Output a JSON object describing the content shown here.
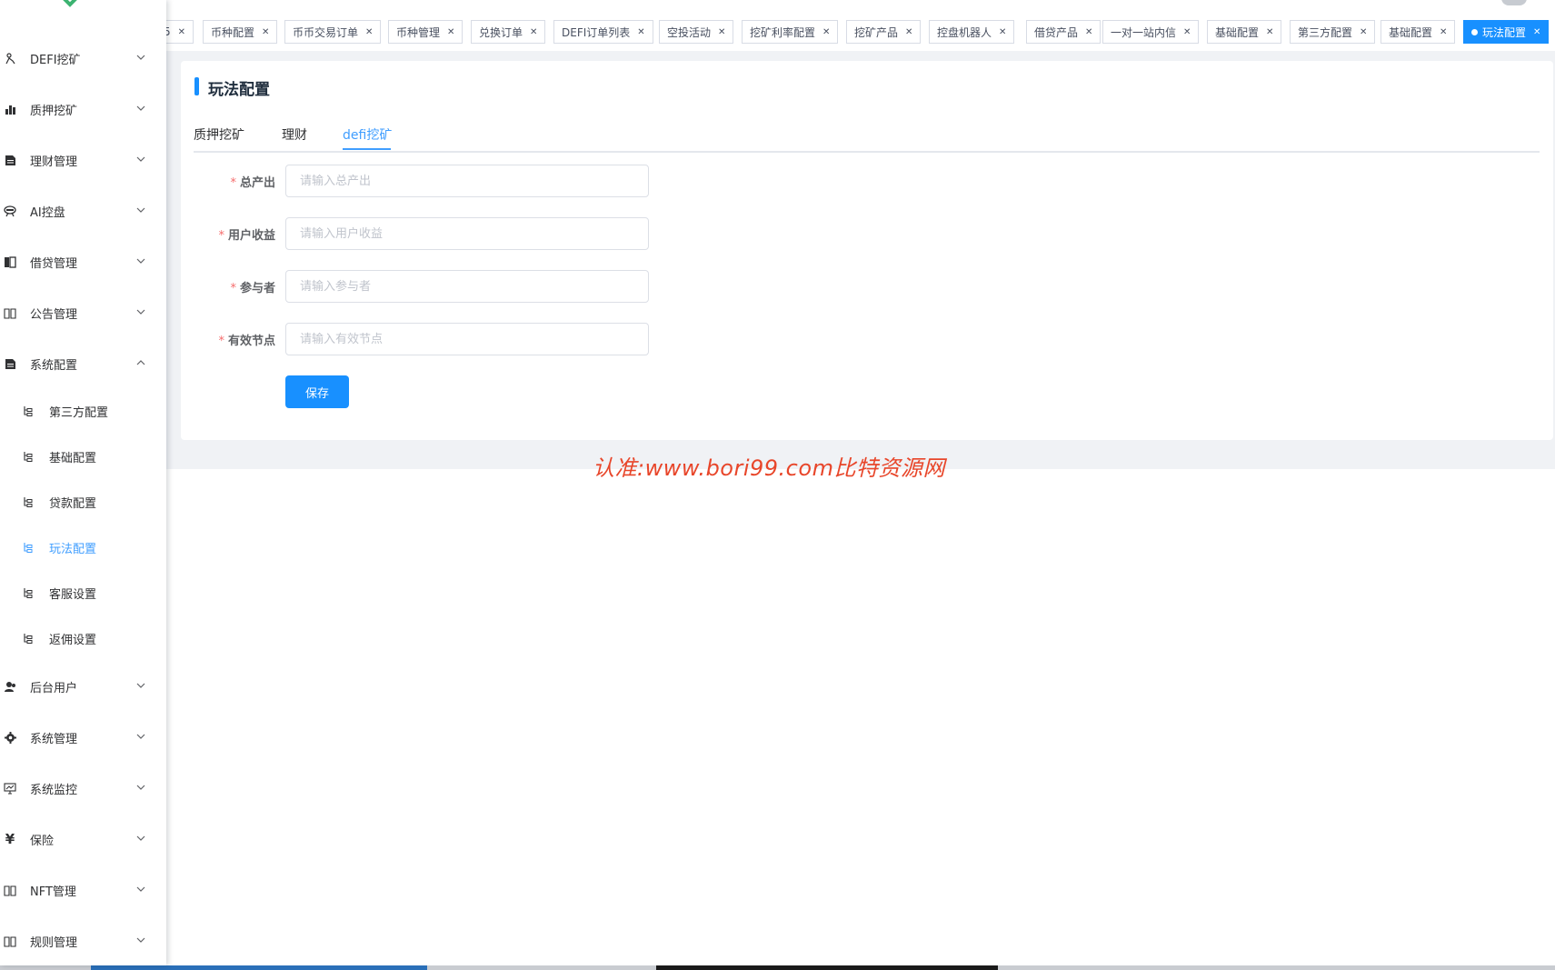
{
  "sidebar": {
    "menus": [
      {
        "label": "DEFI挖矿",
        "icon": "defi-icon"
      },
      {
        "label": "质押挖矿",
        "icon": "bar-chart-icon"
      },
      {
        "label": "理财管理",
        "icon": "document-icon"
      },
      {
        "label": "AI控盘",
        "icon": "robot-icon"
      },
      {
        "label": "借贷管理",
        "icon": "book-icon"
      },
      {
        "label": "公告管理",
        "icon": "open-book-icon"
      },
      {
        "label": "系统配置",
        "icon": "document-icon"
      },
      {
        "label": "后台用户",
        "icon": "user-icon"
      },
      {
        "label": "系统管理",
        "icon": "gear-icon"
      },
      {
        "label": "系统监控",
        "icon": "monitor-icon"
      },
      {
        "label": "保险",
        "icon": "yen-icon"
      },
      {
        "label": "NFT管理",
        "icon": "open-book-icon"
      },
      {
        "label": "规则管理",
        "icon": "open-book-icon"
      }
    ],
    "submenu": [
      {
        "label": "第三方配置"
      },
      {
        "label": "基础配置"
      },
      {
        "label": "贷款配置"
      },
      {
        "label": "玩法配置"
      },
      {
        "label": "客服设置"
      },
      {
        "label": "返佣设置"
      }
    ]
  },
  "tags": [
    {
      "label": "5"
    },
    {
      "label": "币种配置"
    },
    {
      "label": "币币交易订单"
    },
    {
      "label": "币种管理"
    },
    {
      "label": "兑换订单"
    },
    {
      "label": "DEFI订单列表"
    },
    {
      "label": "空投活动"
    },
    {
      "label": "挖矿利率配置"
    },
    {
      "label": "挖矿产品"
    },
    {
      "label": "控盘机器人"
    },
    {
      "label": "借贷产品"
    },
    {
      "label": "一对一站内信"
    },
    {
      "label": "基础配置"
    },
    {
      "label": "第三方配置"
    },
    {
      "label": "基础配置"
    },
    {
      "label": "玩法配置"
    }
  ],
  "page": {
    "title": "玩法配置",
    "tabs": [
      {
        "label": "质押挖矿"
      },
      {
        "label": "理财"
      },
      {
        "label": "defi挖矿"
      }
    ],
    "active_tab": "defi挖矿"
  },
  "form": {
    "fields": [
      {
        "label": "总产出",
        "placeholder": "请输入总产出",
        "value": ""
      },
      {
        "label": "用户收益",
        "placeholder": "请输入用户收益",
        "value": ""
      },
      {
        "label": "参与者",
        "placeholder": "请输入参与者",
        "value": ""
      },
      {
        "label": "有效节点",
        "placeholder": "请输入有效节点",
        "value": ""
      }
    ],
    "required_mark": "*",
    "save_label": "保存"
  },
  "watermark": "认准:www.bori99.com比特资源网",
  "colors": {
    "accent": "#1890ff",
    "active_text": "#409eff",
    "required": "#f56c6c",
    "watermark": "#e8462a"
  }
}
